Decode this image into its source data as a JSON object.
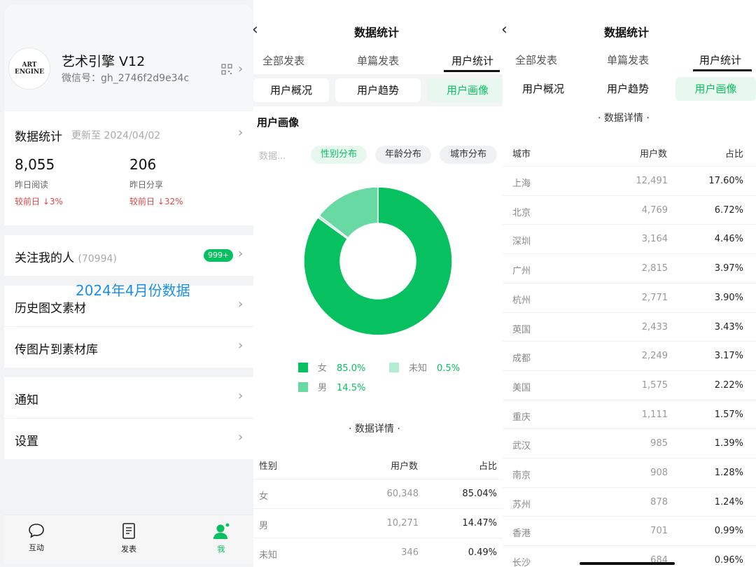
{
  "p1": {
    "account": {
      "name": "艺术引擎 V12",
      "wechat_id": "微信号：gh_2746f2d9e34c",
      "logo_text_1": "ART",
      "logo_text_2": "ENGINE"
    },
    "stats": {
      "title": "数据统计",
      "updated": "更新至 2024/04/02",
      "items": [
        {
          "value": "8,055",
          "label": "昨日阅读",
          "compare": "较前日 ↓3%"
        },
        {
          "value": "206",
          "label": "昨日分享",
          "compare": "较前日 ↓32%"
        }
      ]
    },
    "menu": {
      "followers_label": "关注我的人",
      "followers_count": "(70994)",
      "followers_badge": "999+",
      "history": "历史图文素材",
      "upload": "传图片到素材库",
      "notify": "通知",
      "settings": "设置"
    },
    "overlay_text": "2024年4月份数据",
    "tabbar": [
      {
        "label": "互动",
        "icon": "chat-bubble-icon"
      },
      {
        "label": "发表",
        "icon": "document-icon"
      },
      {
        "label": "我",
        "icon": "person-icon",
        "active": true
      }
    ]
  },
  "p2": {
    "title": "数据统计",
    "top_tabs": [
      "全部发表",
      "单篇发表",
      "用户统计"
    ],
    "active_top_tab": "用户统计",
    "segments": [
      "用户概况",
      "用户趋势",
      "用户画像"
    ],
    "active_segment": "用户画像",
    "section_title": "用户画像",
    "pill_dim": "数据...",
    "pills": [
      "性别分布",
      "年龄分布",
      "城市分布"
    ],
    "active_pill": "性别分布",
    "legend": [
      {
        "label": "女",
        "value": "85.0%",
        "color": "#07c160"
      },
      {
        "label": "未知",
        "value": "0.5%",
        "color": "#b3ecd0"
      },
      {
        "label": "男",
        "value": "14.5%",
        "color": "#69d9a3"
      }
    ],
    "detail_title": "· 数据详情 ·",
    "table_headers": [
      "性别",
      "用户数",
      "占比"
    ],
    "table_rows": [
      [
        "女",
        "60,348",
        "85.04%"
      ],
      [
        "男",
        "10,271",
        "14.47%"
      ],
      [
        "未知",
        "346",
        "0.49%"
      ]
    ]
  },
  "chart_data": {
    "type": "pie",
    "categories": [
      "女",
      "男",
      "未知"
    ],
    "values": [
      85.0,
      14.5,
      0.5
    ],
    "colors": [
      "#07c160",
      "#69d9a3",
      "#b3ecd0"
    ],
    "donut": true,
    "title": ""
  },
  "p3": {
    "title": "数据统计",
    "top_tabs": [
      "全部发表",
      "单篇发表",
      "用户统计"
    ],
    "active_top_tab": "用户统计",
    "segments": [
      "用户概况",
      "用户趋势",
      "用户画像"
    ],
    "active_segment": "用户画像",
    "detail_title": "· 数据详情 ·",
    "table_headers": [
      "城市",
      "用户数",
      "占比"
    ],
    "table_rows": [
      [
        "上海",
        "12,491",
        "17.60%"
      ],
      [
        "北京",
        "4,769",
        "6.72%"
      ],
      [
        "深圳",
        "3,164",
        "4.46%"
      ],
      [
        "广州",
        "2,815",
        "3.97%"
      ],
      [
        "杭州",
        "2,771",
        "3.90%"
      ],
      [
        "英国",
        "2,433",
        "3.43%"
      ],
      [
        "成都",
        "2,249",
        "3.17%"
      ],
      [
        "美国",
        "1,575",
        "2.22%"
      ],
      [
        "重庆",
        "1,111",
        "1.57%"
      ],
      [
        "武汉",
        "985",
        "1.39%"
      ],
      [
        "南京",
        "908",
        "1.28%"
      ],
      [
        "苏州",
        "878",
        "1.24%"
      ],
      [
        "香港",
        "701",
        "0.99%"
      ],
      [
        "长沙",
        "684",
        "0.96%"
      ]
    ]
  }
}
